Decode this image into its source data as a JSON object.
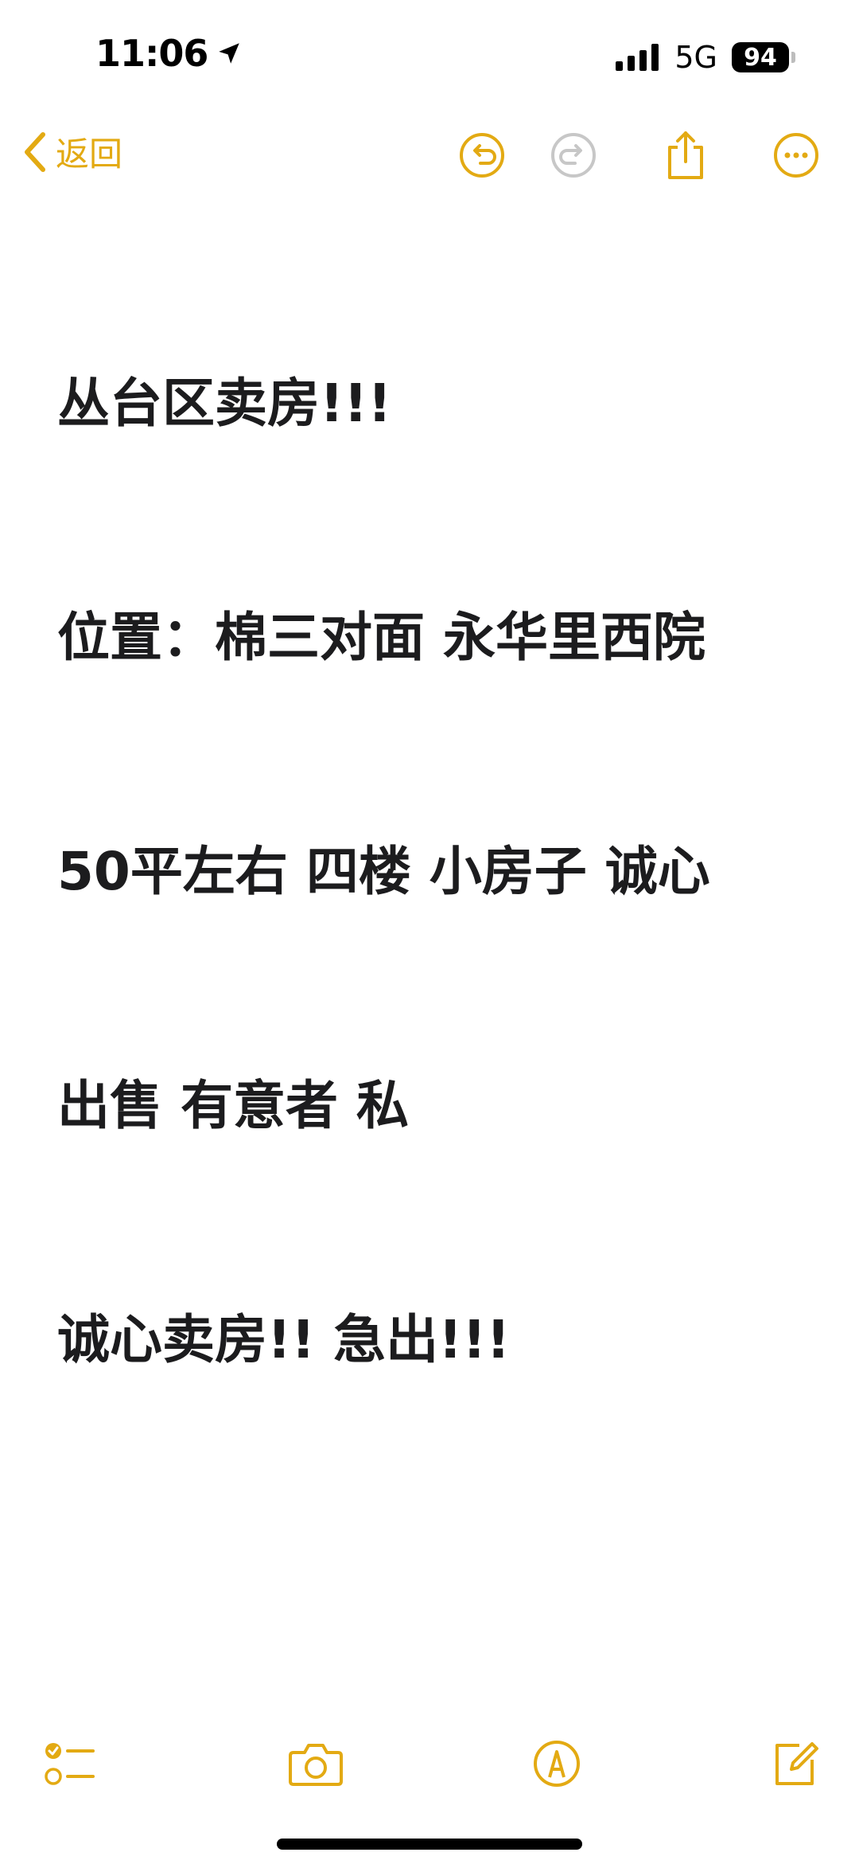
{
  "status_bar": {
    "time": "11:06",
    "network": "5G",
    "battery": "94"
  },
  "nav": {
    "back_label": "返回"
  },
  "note": {
    "lines": [
      "丛台区卖房!!!",
      "位置：棉三对面 永华里西院",
      "50平左右 四楼 小房子 诚心",
      "出售 有意者 私",
      "诚心卖房!! 急出!!!"
    ]
  },
  "colors": {
    "accent": "#E3AA13",
    "disabled": "#C7C7C7",
    "text": "#1C1C1E"
  },
  "icons": {
    "location": "location-arrow-icon",
    "signal": "cellular-signal-icon",
    "back": "chevron-left-icon",
    "undo": "undo-icon",
    "redo": "redo-icon",
    "share": "share-icon",
    "more": "more-icon",
    "checklist": "checklist-icon",
    "camera": "camera-icon",
    "markup": "markup-pen-icon",
    "compose": "compose-icon"
  }
}
